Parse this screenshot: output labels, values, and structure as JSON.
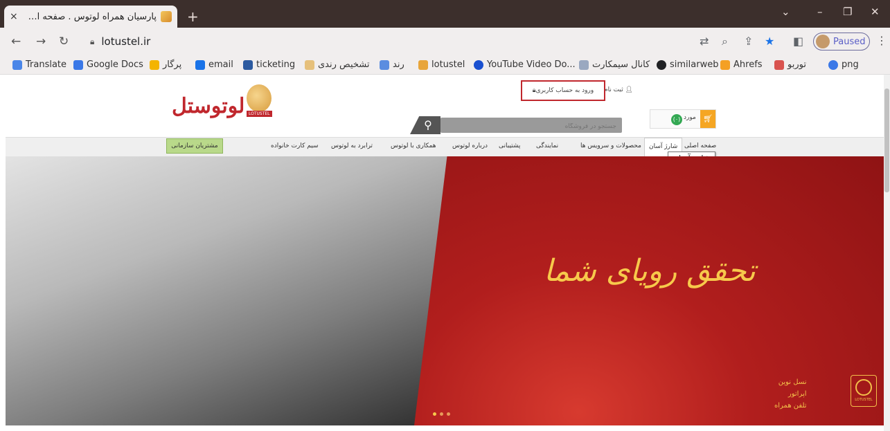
{
  "browser": {
    "tab_title": "پارسیان همراه لوتوس . صفحه اصلی",
    "tab_close": "×",
    "new_tab": "+",
    "url": "lotustel.ir",
    "profile_status": "Paused",
    "window_controls": [
      "⌄",
      "–",
      "❐",
      "✕"
    ]
  },
  "bookmarks": [
    {
      "label": "Translate",
      "color": "#4a86e8"
    },
    {
      "label": "Google Docs",
      "color": "#3b78e7"
    },
    {
      "label": "پرگار",
      "color": "#f4b400"
    },
    {
      "label": "email",
      "color": "#1a73e8"
    },
    {
      "label": "ticketing",
      "color": "#2c5aa0"
    },
    {
      "label": "تشخیص رندی",
      "color": "#e6c07b"
    },
    {
      "label": "رند",
      "color": "#5b8de0"
    },
    {
      "label": "lotustel",
      "color": "#e8a53a"
    },
    {
      "label": "YouTube Video Do...",
      "color": "#1a50d0"
    },
    {
      "label": "کانال سیمکارت",
      "color": "#9aa8c0"
    },
    {
      "label": "similarweb",
      "color": "#202124"
    },
    {
      "label": "Ahrefs",
      "color": "#f4a024"
    },
    {
      "label": "توربو",
      "color": "#d9534f"
    },
    {
      "label": "png",
      "color": "#3b78e7"
    }
  ],
  "site": {
    "logo_text": "لوتوستل",
    "logo_sub": "LOTUSTEL",
    "signup": "ثبت نام",
    "login": "ورود به حساب کاربری",
    "search_placeholder": "جستجو در فروشگاه",
    "cart_count": "(۰)",
    "cart_label": "مورد",
    "nav": [
      "صفحه اصلی",
      "شارژ آسان",
      "محصولات و سرویس ها",
      "نمایندگی",
      "پشتیبانی",
      "درباره لوتوس",
      "همکاری با لوتوس",
      "ترابرد به لوتوس",
      "سیم کارت خانواده"
    ],
    "org_customers": "مشتریان سازمانی",
    "tooltip": "شارژ آسان",
    "hero_tagline": "تحقق رویای شما",
    "hero_slogan": [
      "نسل نوین",
      "اپراتور",
      "تلفن همراه"
    ],
    "hero_logo_text": "LOTUSTEL",
    "accent": "#c0272d"
  }
}
